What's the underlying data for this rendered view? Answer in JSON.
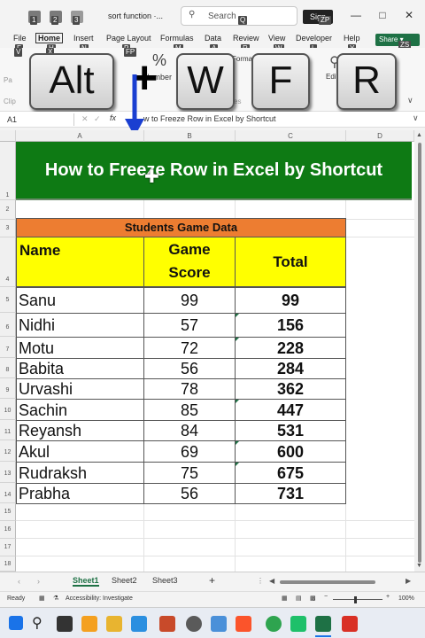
{
  "titlebar": {
    "doc_title": "sort function ·...",
    "search_placeholder": "Search",
    "signin_label": "Sign",
    "keytips": [
      "1",
      "2",
      "3",
      "Q",
      "ZP"
    ]
  },
  "ribbon_tabs": [
    {
      "label": "File",
      "keytip": "F"
    },
    {
      "label": "Home",
      "keytip": "H"
    },
    {
      "label": "Insert",
      "keytip": "N"
    },
    {
      "label": "Page Layout",
      "keytip": "P"
    },
    {
      "label": "Formulas",
      "keytip": "M"
    },
    {
      "label": "Data",
      "keytip": "A"
    },
    {
      "label": "Review",
      "keytip": "R"
    },
    {
      "label": "View",
      "keytip": "W"
    },
    {
      "label": "Developer",
      "keytip": "L"
    },
    {
      "label": "Help",
      "keytip": "Y"
    }
  ],
  "share_label": "Share",
  "share_keytip": "ZS",
  "ribbon_fragments": {
    "number": "Number",
    "format": "Format",
    "editing": "Editi",
    "styles": "es",
    "paste": "Pa",
    "clipboard": "Clip"
  },
  "overlay_keys": [
    "Alt",
    "+",
    "W",
    "F",
    "R"
  ],
  "formula_bar": {
    "name_box": "A1",
    "fx": "fx",
    "formula": "w to Freeze Row in Excel by Shortcut"
  },
  "columns": [
    "A",
    "B",
    "C",
    "D"
  ],
  "rows": [
    "1",
    "2",
    "3",
    "4",
    "5",
    "6",
    "7",
    "8",
    "9",
    "10",
    "11",
    "12",
    "13",
    "14",
    "15",
    "16",
    "17",
    "18",
    "19"
  ],
  "banner_title": "How to Freeze Row in Excel by Shortcut",
  "table": {
    "caption": "Students Game Data",
    "headers": [
      "Name",
      "Game",
      "Score",
      "Total"
    ],
    "records": [
      {
        "name": "Sanu",
        "score": "99",
        "total": "99"
      },
      {
        "name": "Nidhi",
        "score": "57",
        "total": "156"
      },
      {
        "name": "Motu",
        "score": "72",
        "total": "228"
      },
      {
        "name": "Babita",
        "score": "56",
        "total": "284"
      },
      {
        "name": "Urvashi",
        "score": "78",
        "total": "362"
      },
      {
        "name": "Sachin",
        "score": "85",
        "total": "447"
      },
      {
        "name": "Reyansh",
        "score": "84",
        "total": "531"
      },
      {
        "name": "Akul",
        "score": "69",
        "total": "600"
      },
      {
        "name": "Rudraksh",
        "score": "75",
        "total": "675"
      },
      {
        "name": "Prabha",
        "score": "56",
        "total": "731"
      }
    ]
  },
  "sheets": [
    "Sheet1",
    "Sheet2",
    "Sheet3"
  ],
  "active_sheet": "Sheet1",
  "add_sheet": "+",
  "status": {
    "ready": "Ready",
    "accessibility": "Accessibility: Investigate",
    "zoom": "100%"
  },
  "colors": {
    "banner": "#0e7a14",
    "caption": "#ed7d31",
    "header": "#ffff00",
    "excel_green": "#1e7145",
    "arrow": "#1a3fd1"
  }
}
